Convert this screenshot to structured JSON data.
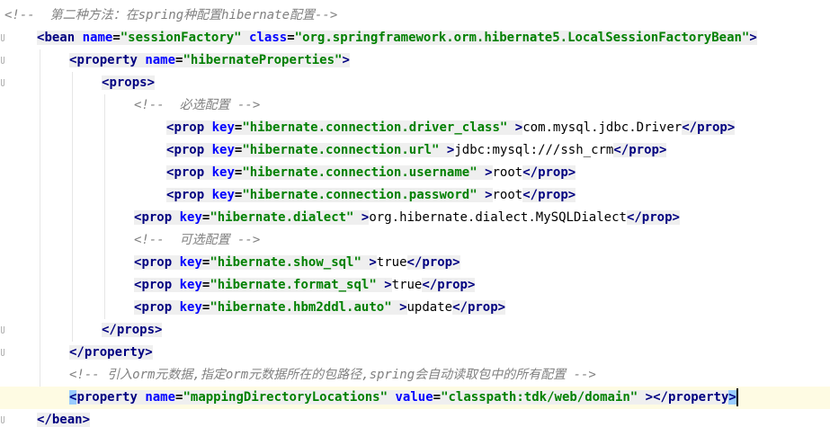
{
  "lines": [
    {
      "indent": 0,
      "comment": "<!--  第二种方法：在spring种配置hibernate配置-->"
    },
    {
      "indent": 1,
      "open": "bean",
      "attrs": [
        {
          "n": "name",
          "v": "\"sessionFactory\""
        },
        {
          "n": "class",
          "v": "\"org.springframework.orm.hibernate5.LocalSessionFactoryBean\""
        }
      ]
    },
    {
      "indent": 2,
      "open": "property",
      "attrs": [
        {
          "n": "name",
          "v": "\"hibernateProperties\""
        }
      ]
    },
    {
      "indent": 3,
      "open": "props",
      "attrs": []
    },
    {
      "indent": 4,
      "comment": "<!--  必选配置 -->"
    },
    {
      "indent": 5,
      "prop_key": "\"hibernate.connection.driver_class\"",
      "text": "com.mysql.jdbc.Driver"
    },
    {
      "indent": 5,
      "prop_key": "\"hibernate.connection.url\"",
      "text": "jdbc:mysql:///ssh_crm"
    },
    {
      "indent": 5,
      "prop_key": "\"hibernate.connection.username\"",
      "text": "root"
    },
    {
      "indent": 5,
      "prop_key": "\"hibernate.connection.password\"",
      "text": "root"
    },
    {
      "indent": 4,
      "prop_key": "\"hibernate.dialect\"",
      "text": "org.hibernate.dialect.MySQLDialect"
    },
    {
      "indent": 4,
      "comment": "<!--  可选配置 -->"
    },
    {
      "indent": 4,
      "prop_key": "\"hibernate.show_sql\"",
      "text": "true"
    },
    {
      "indent": 4,
      "prop_key": "\"hibernate.format_sql\"",
      "text": "true"
    },
    {
      "indent": 4,
      "prop_key": "\"hibernate.hbm2ddl.auto\"",
      "text": "update"
    },
    {
      "indent": 3,
      "close": "props"
    },
    {
      "indent": 2,
      "close": "property"
    },
    {
      "indent": 2,
      "comment": "<!-- 引入orm元数据,指定orm元数据所在的包路径,spring会自动读取包中的所有配置 -->"
    },
    {
      "indent": 2,
      "current": true,
      "mapping": true,
      "attrs": [
        {
          "n": "name",
          "v": "\"mappingDirectoryLocations\""
        },
        {
          "n": "value",
          "v": "\"classpath:tdk/web/domain\""
        }
      ]
    },
    {
      "indent": 1,
      "close": "bean"
    }
  ],
  "tokens": {
    "lt": "<",
    "gt": ">",
    "lt_slash": "</",
    "eq": "=",
    "space": " ",
    "prop": "prop",
    "key": "key",
    "property": "property"
  }
}
